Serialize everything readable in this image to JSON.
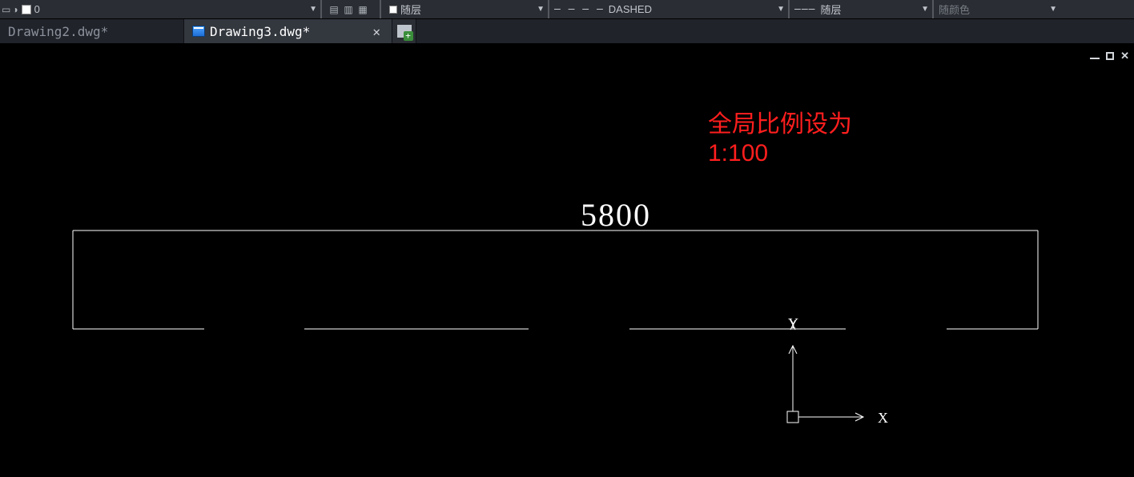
{
  "toolbar": {
    "layer": {
      "name": "0"
    },
    "prop_color": "随层",
    "prop_linetype": {
      "pattern": "– – – –",
      "name": "DASHED"
    },
    "prop_lineweight": {
      "sample": "———",
      "name": "随层"
    },
    "prop_plotcolor": "随颜色"
  },
  "tabs": [
    {
      "label": "Drawing2.dwg*",
      "active": false
    },
    {
      "label": "Drawing3.dwg*",
      "active": true
    }
  ],
  "drawing": {
    "dimension_value": "5800",
    "axis_x": "X",
    "axis_y": "Y"
  },
  "annotation": {
    "line1": "全局比例设为",
    "line2": "1:100"
  }
}
